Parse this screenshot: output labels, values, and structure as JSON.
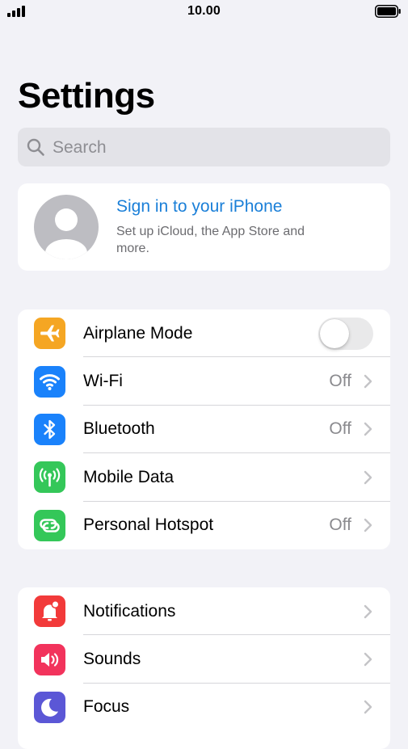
{
  "status_bar": {
    "time": "10.00"
  },
  "header": {
    "title": "Settings"
  },
  "search": {
    "placeholder": "Search"
  },
  "profile": {
    "title": "Sign in to your iPhone",
    "subtitle": "Set up iCloud, the App Store and more."
  },
  "groups": [
    {
      "rows": [
        {
          "label": "Airplane Mode",
          "value": "",
          "icon": "airplane-icon",
          "icon_color": "#f5a623",
          "control": "toggle",
          "toggle_on": false
        },
        {
          "label": "Wi-Fi",
          "value": "Off",
          "icon": "wifi-icon",
          "icon_color": "#1a82fb"
        },
        {
          "label": "Bluetooth",
          "value": "Off",
          "icon": "bluetooth-icon",
          "icon_color": "#1a82fb"
        },
        {
          "label": "Mobile Data",
          "value": "",
          "icon": "antenna-icon",
          "icon_color": "#34c759"
        },
        {
          "label": "Personal Hotspot",
          "value": "Off",
          "icon": "hotspot-icon",
          "icon_color": "#34c759"
        }
      ]
    },
    {
      "rows": [
        {
          "label": "Notifications",
          "value": "",
          "icon": "notification-bell-icon",
          "icon_color": "#f23a3a"
        },
        {
          "label": "Sounds",
          "value": "",
          "icon": "speaker-icon",
          "icon_color": "#f2335c"
        },
        {
          "label": "Focus",
          "value": "",
          "icon": "moon-icon",
          "icon_color": "#5b57d6"
        }
      ]
    }
  ]
}
